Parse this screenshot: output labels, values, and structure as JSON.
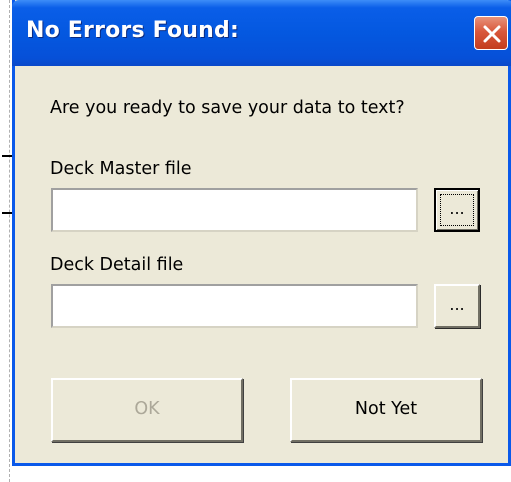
{
  "window": {
    "title": "No Errors Found:",
    "close_icon": "close-icon",
    "title_color": "#0458e0",
    "close_color": "#d9583c"
  },
  "dialog": {
    "prompt": "Are you ready to save your data to text?",
    "master": {
      "label": "Deck Master file",
      "value": "",
      "browse_label": "..."
    },
    "detail": {
      "label": "Deck Detail file",
      "value": "",
      "browse_label": "..."
    },
    "ok_label": "OK",
    "not_yet_label": "Not Yet"
  }
}
